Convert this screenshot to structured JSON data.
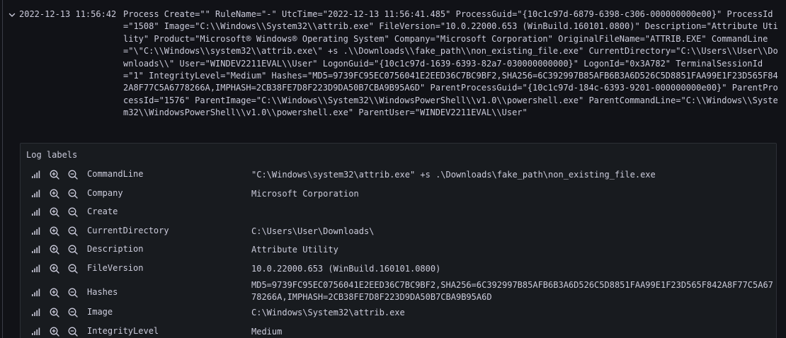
{
  "log": {
    "timestamp": "2022-12-13 11:56:42",
    "line": "Process Create=\"\" RuleName=\"-\" UtcTime=\"2022-12-13 11:56:41.485\" ProcessGuid=\"{10c1c97d-6879-6398-c306-000000000e00}\" ProcessId=\"1508\" Image=\"C:\\\\Windows\\\\System32\\\\attrib.exe\" FileVersion=\"10.0.22000.653 (WinBuild.160101.0800)\" Description=\"Attribute Utility\" Product=\"Microsoft® Windows® Operating System\" Company=\"Microsoft Corporation\" OriginalFileName=\"ATTRIB.EXE\" CommandLine=\"\\\"C:\\\\Windows\\\\system32\\\\attrib.exe\\\" +s .\\\\Downloads\\\\fake_path\\\\non_existing_file.exe\" CurrentDirectory=\"C:\\\\Users\\\\User\\\\Downloads\\\\\" User=\"WINDEV2211EVAL\\\\User\" LogonGuid=\"{10c1c97d-1639-6393-82a7-030000000000}\" LogonId=\"0x3A782\" TerminalSessionId=\"1\" IntegrityLevel=\"Medium\" Hashes=\"MD5=9739FC95EC0756041E2EED36C7BC9BF2,SHA256=6C392997B85AFB6B3A6D526C5D8851FAA99E1F23D565F842A8F77C5A6778266A,IMPHASH=2CB38FE7D8F223D9DA50B7CBA9B95A6D\" ParentProcessGuid=\"{10c1c97d-184c-6393-9201-000000000e00}\" ParentProcessId=\"1576\" ParentImage=\"C:\\\\Windows\\\\System32\\\\WindowsPowerShell\\\\v1.0\\\\powershell.exe\" ParentCommandLine=\"C:\\\\Windows\\\\System32\\\\WindowsPowerShell\\\\v1.0\\\\powershell.exe\" ParentUser=\"WINDEV2211EVAL\\\\User\""
  },
  "labels_panel": {
    "title": "Log labels",
    "rows": [
      {
        "key": "CommandLine",
        "value": "\"C:\\Windows\\system32\\attrib.exe\" +s .\\Downloads\\fake_path\\non_existing_file.exe"
      },
      {
        "key": "Company",
        "value": "Microsoft Corporation"
      },
      {
        "key": "Create",
        "value": ""
      },
      {
        "key": "CurrentDirectory",
        "value": "C:\\Users\\User\\Downloads\\"
      },
      {
        "key": "Description",
        "value": "Attribute Utility"
      },
      {
        "key": "FileVersion",
        "value": "10.0.22000.653 (WinBuild.160101.0800)"
      },
      {
        "key": "Hashes",
        "value": "MD5=9739FC95EC0756041E2EED36C7BC9BF2,SHA256=6C392997B85AFB6B3A6D526C5D8851FAA99E1F23D565F842A8F77C5A6778266A,IMPHASH=2CB38FE7D8F223D9DA50B7CBA9B95A6D"
      },
      {
        "key": "Image",
        "value": "C:\\Windows\\System32\\attrib.exe"
      },
      {
        "key": "IntegrityLevel",
        "value": "Medium"
      }
    ]
  },
  "icons": {
    "expand": "chevron-down-icon",
    "stats": "bar-chart-icon",
    "filter_for": "zoom-in-icon",
    "filter_out": "zoom-out-icon"
  },
  "colors": {
    "background": "#111217",
    "panel": "#181b1f",
    "border": "#2c2f36",
    "text": "#ccccdc"
  }
}
